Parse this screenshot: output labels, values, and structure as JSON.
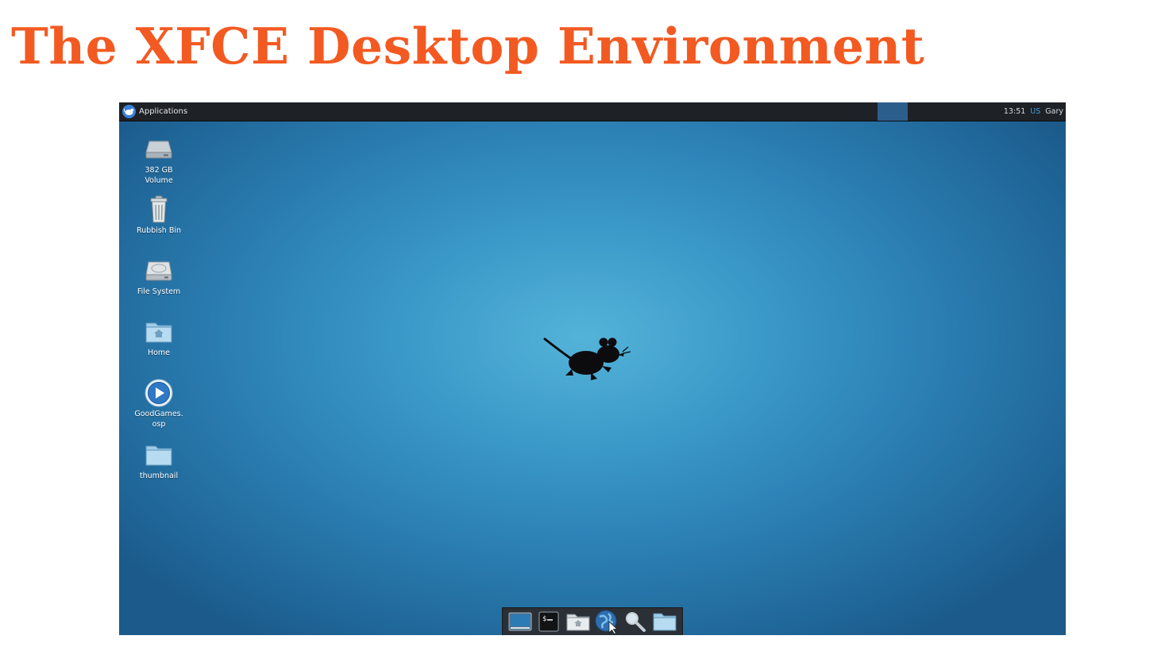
{
  "heading": "The XFCE Desktop Environment",
  "colors": {
    "heading": "#f25a22",
    "panel": "#1e2125",
    "desktop_center": "#54b3d8",
    "desktop_edge": "#1b5a8b"
  },
  "top_panel": {
    "applications_label": "Applications",
    "clock": "13:51",
    "keyboard_layout": "US",
    "user": "Gary"
  },
  "desktop_icons": [
    {
      "label": "382 GB\nVolume",
      "icon": "drive-icon"
    },
    {
      "label": "Rubbish Bin",
      "icon": "trash-icon"
    },
    {
      "label": "File System",
      "icon": "harddisk-icon"
    },
    {
      "label": "Home",
      "icon": "home-folder-icon"
    },
    {
      "label": "GoodGames.\nosp",
      "icon": "media-file-icon"
    },
    {
      "label": "thumbnail",
      "icon": "folder-icon"
    }
  ],
  "dock_items": [
    "show-desktop-icon",
    "terminal-icon",
    "file-manager-icon",
    "web-browser-icon",
    "search-icon",
    "folder-icon"
  ]
}
